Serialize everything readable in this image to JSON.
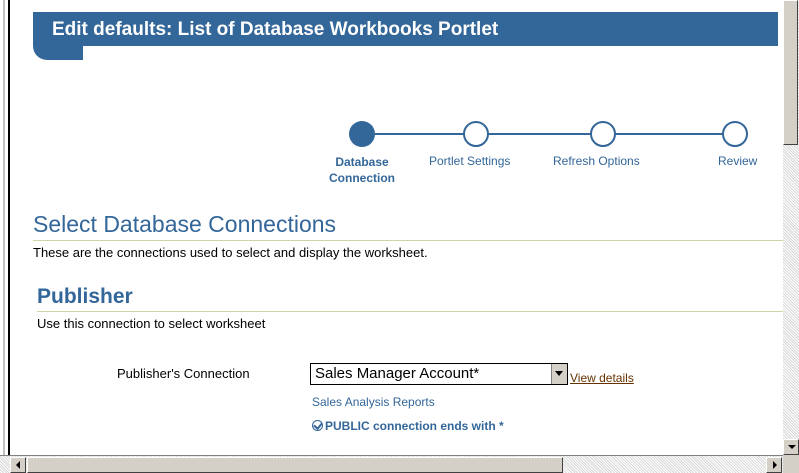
{
  "header": {
    "title": "Edit defaults: List of Database Workbooks Portlet"
  },
  "train": {
    "steps": [
      {
        "label": "Database Connection",
        "line1": "Database",
        "line2": "Connection",
        "state": "active"
      },
      {
        "label": "Portlet Settings",
        "state": "pending"
      },
      {
        "label": "Refresh Options",
        "state": "pending"
      },
      {
        "label": "Review",
        "state": "pending"
      }
    ]
  },
  "section": {
    "title": "Select Database Connections",
    "description": "These are the connections used to select and display the worksheet."
  },
  "publisher": {
    "title": "Publisher",
    "description": "Use this connection to select worksheet",
    "field_label": "Publisher's Connection",
    "selected_value": "Sales Manager Account*",
    "view_details": "View details",
    "sub_text": "Sales Analysis Reports",
    "public_note": "PUBLIC connection ends with *"
  },
  "colors": {
    "brand": "#336699",
    "link": "#663300",
    "rule": "#ccd5a8"
  },
  "icons": {
    "check": "check-circle-icon",
    "train_active": "filled-circle-icon",
    "train_pending": "empty-circle-icon"
  }
}
